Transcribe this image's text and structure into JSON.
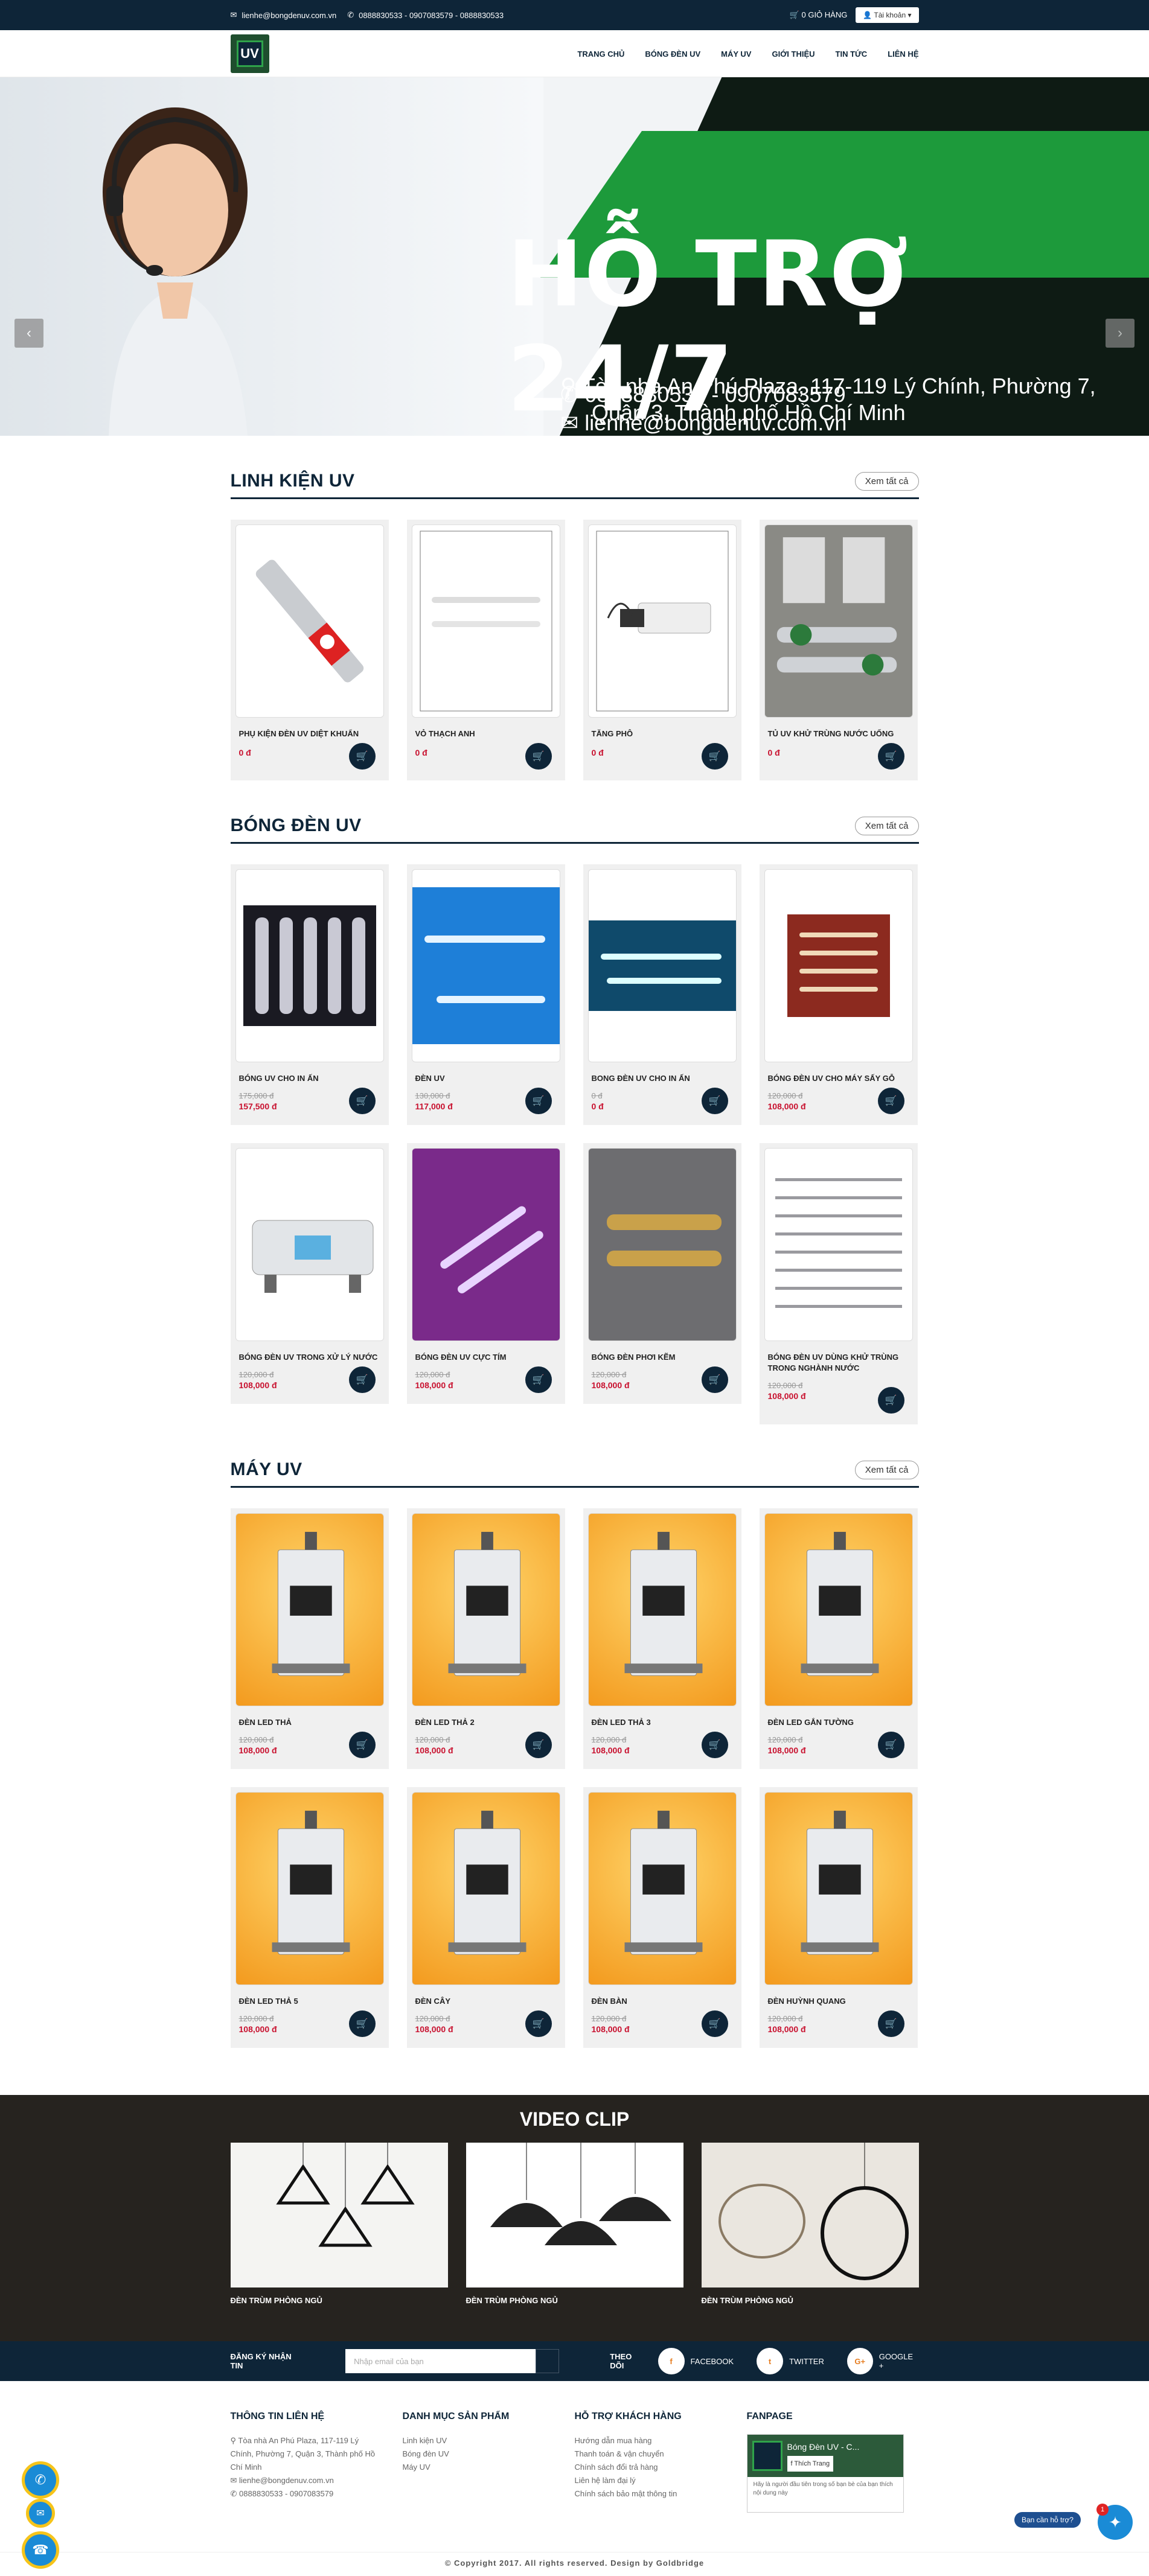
{
  "topbar": {
    "email": "lienhe@bongdenuv.com.vn",
    "phones": "0888830533 - 0907083579 - 0888830533",
    "cart": "0 GIỎ HÀNG",
    "account": "Tài khoản"
  },
  "nav": [
    "TRANG CHỦ",
    "BÓNG ĐÈN UV",
    "MÁY UV",
    "GIỚI THIỆU",
    "TIN TỨC",
    "LIÊN HỆ"
  ],
  "banner": {
    "title": "HỖ TRỢ 24/7",
    "phone": "0888830533 - 0907083579",
    "email": "lienhe@bongdenuv.com.vn",
    "address_line1": "Tòa nhà An Phú Plaza, 117-119 Lý Chính, Phường 7,",
    "address_line2": "Quận 3, Thành phố Hồ Chí Minh"
  },
  "view_all": "Xem tất cả",
  "sections": [
    {
      "title": "LINH KIỆN UV",
      "products": [
        {
          "name": "PHỤ KIỆN ĐÈN UV DIỆT KHUẨN",
          "old": "",
          "price": "0 đ"
        },
        {
          "name": "VỎ THẠCH ANH",
          "old": "",
          "price": "0 đ"
        },
        {
          "name": "TĂNG PHÔ",
          "old": "",
          "price": "0 đ"
        },
        {
          "name": "TỦ UV KHỬ TRÙNG NƯỚC UỐNG",
          "old": "",
          "price": "0 đ"
        }
      ]
    },
    {
      "title": "BÓNG ĐÈN UV",
      "products": [
        {
          "name": "BÓNG UV CHO IN ẤN",
          "old": "175,000 đ",
          "price": "157,500 đ"
        },
        {
          "name": "ĐÈN UV",
          "old": "130,000 đ",
          "price": "117,000 đ"
        },
        {
          "name": "BONG ĐÈN UV CHO IN ẤN",
          "old": "0 đ",
          "price": "0 đ"
        },
        {
          "name": "BÓNG ĐÈN UV CHO MÁY SẤY GỖ",
          "old": "120,000 đ",
          "price": "108,000 đ"
        },
        {
          "name": "BÓNG ĐÈN UV TRONG XỬ LÝ NƯỚC",
          "old": "120,000 đ",
          "price": "108,000 đ"
        },
        {
          "name": "BÓNG ĐÈN UV CỰC TÍM",
          "old": "120,000 đ",
          "price": "108,000 đ"
        },
        {
          "name": "BÓNG ĐÈN PHƠI KẼM",
          "old": "120,000 đ",
          "price": "108,000 đ"
        },
        {
          "name": "BÓNG ĐÈN UV DÙNG KHỬ TRÙNG TRONG NGHÀNH NƯỚC",
          "old": "120,000 đ",
          "price": "108,000 đ"
        }
      ]
    },
    {
      "title": "MÁY UV",
      "products": [
        {
          "name": "ĐÈN LED THẢ",
          "old": "120,000 đ",
          "price": "108,000 đ"
        },
        {
          "name": "ĐÈN LED THẢ 2",
          "old": "120,000 đ",
          "price": "108,000 đ"
        },
        {
          "name": "ĐÈN LED THẢ 3",
          "old": "120,000 đ",
          "price": "108,000 đ"
        },
        {
          "name": "ĐÈN LED GẮN TƯỜNG",
          "old": "120,000 đ",
          "price": "108,000 đ"
        },
        {
          "name": "ĐÈN LED THẢ 5",
          "old": "120,000 đ",
          "price": "108,000 đ"
        },
        {
          "name": "ĐÈN CÂY",
          "old": "120,000 đ",
          "price": "108,000 đ"
        },
        {
          "name": "ĐÈN BÀN",
          "old": "120,000 đ",
          "price": "108,000 đ"
        },
        {
          "name": "ĐÈN HUỲNH QUANG",
          "old": "120,000 đ",
          "price": "108,000 đ"
        }
      ]
    }
  ],
  "video": {
    "title": "VIDEO CLIP",
    "items": [
      "ĐÈN TRÙM PHÒNG NGỦ",
      "ĐÈN TRÙM PHÒNG NGỦ",
      "ĐÈN TRÙM PHÒNG NGỦ"
    ]
  },
  "subscribe": {
    "label": "ĐĂNG KÝ NHẬN TIN",
    "placeholder": "Nhập email của bạn",
    "follow": "THEO DÕI",
    "facebook": "FACEBOOK",
    "twitter": "TWITTER",
    "google": "GOOGLE +"
  },
  "footer": {
    "contact_title": "THÔNG TIN LIÊN HỆ",
    "contact_address": "Tòa nhà An Phú Plaza, 117-119 Lý Chính, Phường 7, Quận 3, Thành phố Hồ Chí Minh",
    "contact_email": "lienhe@bongdenuv.com.vn",
    "contact_phone": "0888830533 - 0907083579",
    "category_title": "DANH MỤC SẢN PHẨM",
    "categories": [
      "Linh kiện UV",
      "Bóng đèn UV",
      "Máy UV"
    ],
    "support_title": "HỖ TRỢ KHÁCH HÀNG",
    "support": [
      "Hướng dẫn mua hàng",
      "Thanh toán & vận chuyển",
      "Chính sách đổi trả hàng",
      "Liên hệ làm đại lý",
      "Chính sách bảo mật thông tin"
    ],
    "fanpage_title": "FANPAGE",
    "fanpage_name": "Bóng Đèn UV - C...",
    "fanpage_like": "Thích Trang",
    "fanpage_note": "Hãy là người đầu tiên trong số bạn bè của bạn thích nội dung này",
    "copyright": "© Copyright 2017. All rights reserved. Design by Goldbridge"
  },
  "chat": {
    "label": "Bạn cần hỗ trợ?",
    "badge": "1"
  }
}
